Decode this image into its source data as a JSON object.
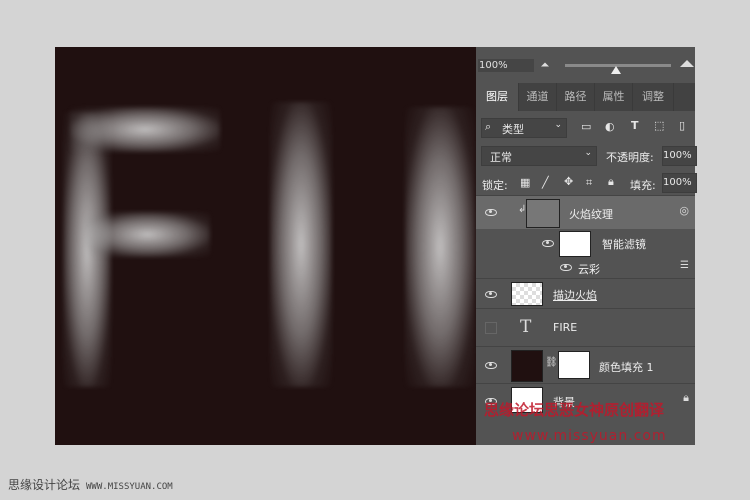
{
  "panel": {
    "zoom_value": "100%",
    "tabs": [
      "图层",
      "通道",
      "路径",
      "属性",
      "调整"
    ],
    "active_tab": "图层",
    "filter_kind": "类型",
    "filter_icons": [
      "image-filter-icon",
      "adjustment-filter-icon",
      "type-filter-icon",
      "shape-filter-icon",
      "smart-object-filter-icon"
    ],
    "blend_mode": "正常",
    "opacity_label": "不透明度:",
    "opacity_value": "100%",
    "lock_label": "锁定:",
    "fill_label": "填充:",
    "fill_value": "100%",
    "layers": [
      {
        "name": "火焰纹理",
        "visible": true,
        "type": "smart-object",
        "clipped": true
      },
      {
        "name": "智能滤镜",
        "visible": true,
        "type": "smart-filter-mask"
      },
      {
        "name": "云彩",
        "visible": true,
        "type": "filter"
      },
      {
        "name": "描边火焰",
        "visible": true,
        "type": "pixel"
      },
      {
        "name": "FIRE",
        "visible": false,
        "type": "text"
      },
      {
        "name": "颜色填充 1",
        "visible": true,
        "type": "fill"
      },
      {
        "name": "背景",
        "visible": true,
        "type": "background",
        "locked": true
      }
    ]
  },
  "watermark": {
    "line1": "思缘论坛思恶女神原创翻译",
    "line2": "www.missyuan.com"
  },
  "footer": {
    "site_name": "思缘设计论坛",
    "url": "WWW.MISSYUAN.COM"
  },
  "colors": {
    "canvas_bg": "#201010",
    "panel_bg": "#535353",
    "watermark": "#c0182a"
  }
}
